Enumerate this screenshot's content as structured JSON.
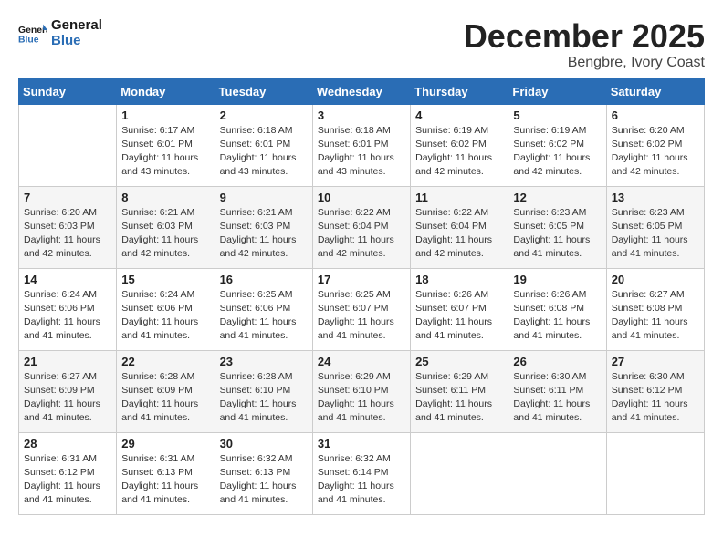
{
  "logo": {
    "text_general": "General",
    "text_blue": "Blue"
  },
  "title": {
    "month_year": "December 2025",
    "location": "Bengbre, Ivory Coast"
  },
  "days_of_week": [
    "Sunday",
    "Monday",
    "Tuesday",
    "Wednesday",
    "Thursday",
    "Friday",
    "Saturday"
  ],
  "weeks": [
    [
      {
        "day": "",
        "sunrise": "",
        "sunset": "",
        "daylight": ""
      },
      {
        "day": "1",
        "sunrise": "Sunrise: 6:17 AM",
        "sunset": "Sunset: 6:01 PM",
        "daylight": "Daylight: 11 hours and 43 minutes."
      },
      {
        "day": "2",
        "sunrise": "Sunrise: 6:18 AM",
        "sunset": "Sunset: 6:01 PM",
        "daylight": "Daylight: 11 hours and 43 minutes."
      },
      {
        "day": "3",
        "sunrise": "Sunrise: 6:18 AM",
        "sunset": "Sunset: 6:01 PM",
        "daylight": "Daylight: 11 hours and 43 minutes."
      },
      {
        "day": "4",
        "sunrise": "Sunrise: 6:19 AM",
        "sunset": "Sunset: 6:02 PM",
        "daylight": "Daylight: 11 hours and 42 minutes."
      },
      {
        "day": "5",
        "sunrise": "Sunrise: 6:19 AM",
        "sunset": "Sunset: 6:02 PM",
        "daylight": "Daylight: 11 hours and 42 minutes."
      },
      {
        "day": "6",
        "sunrise": "Sunrise: 6:20 AM",
        "sunset": "Sunset: 6:02 PM",
        "daylight": "Daylight: 11 hours and 42 minutes."
      }
    ],
    [
      {
        "day": "7",
        "sunrise": "Sunrise: 6:20 AM",
        "sunset": "Sunset: 6:03 PM",
        "daylight": "Daylight: 11 hours and 42 minutes."
      },
      {
        "day": "8",
        "sunrise": "Sunrise: 6:21 AM",
        "sunset": "Sunset: 6:03 PM",
        "daylight": "Daylight: 11 hours and 42 minutes."
      },
      {
        "day": "9",
        "sunrise": "Sunrise: 6:21 AM",
        "sunset": "Sunset: 6:03 PM",
        "daylight": "Daylight: 11 hours and 42 minutes."
      },
      {
        "day": "10",
        "sunrise": "Sunrise: 6:22 AM",
        "sunset": "Sunset: 6:04 PM",
        "daylight": "Daylight: 11 hours and 42 minutes."
      },
      {
        "day": "11",
        "sunrise": "Sunrise: 6:22 AM",
        "sunset": "Sunset: 6:04 PM",
        "daylight": "Daylight: 11 hours and 42 minutes."
      },
      {
        "day": "12",
        "sunrise": "Sunrise: 6:23 AM",
        "sunset": "Sunset: 6:05 PM",
        "daylight": "Daylight: 11 hours and 41 minutes."
      },
      {
        "day": "13",
        "sunrise": "Sunrise: 6:23 AM",
        "sunset": "Sunset: 6:05 PM",
        "daylight": "Daylight: 11 hours and 41 minutes."
      }
    ],
    [
      {
        "day": "14",
        "sunrise": "Sunrise: 6:24 AM",
        "sunset": "Sunset: 6:06 PM",
        "daylight": "Daylight: 11 hours and 41 minutes."
      },
      {
        "day": "15",
        "sunrise": "Sunrise: 6:24 AM",
        "sunset": "Sunset: 6:06 PM",
        "daylight": "Daylight: 11 hours and 41 minutes."
      },
      {
        "day": "16",
        "sunrise": "Sunrise: 6:25 AM",
        "sunset": "Sunset: 6:06 PM",
        "daylight": "Daylight: 11 hours and 41 minutes."
      },
      {
        "day": "17",
        "sunrise": "Sunrise: 6:25 AM",
        "sunset": "Sunset: 6:07 PM",
        "daylight": "Daylight: 11 hours and 41 minutes."
      },
      {
        "day": "18",
        "sunrise": "Sunrise: 6:26 AM",
        "sunset": "Sunset: 6:07 PM",
        "daylight": "Daylight: 11 hours and 41 minutes."
      },
      {
        "day": "19",
        "sunrise": "Sunrise: 6:26 AM",
        "sunset": "Sunset: 6:08 PM",
        "daylight": "Daylight: 11 hours and 41 minutes."
      },
      {
        "day": "20",
        "sunrise": "Sunrise: 6:27 AM",
        "sunset": "Sunset: 6:08 PM",
        "daylight": "Daylight: 11 hours and 41 minutes."
      }
    ],
    [
      {
        "day": "21",
        "sunrise": "Sunrise: 6:27 AM",
        "sunset": "Sunset: 6:09 PM",
        "daylight": "Daylight: 11 hours and 41 minutes."
      },
      {
        "day": "22",
        "sunrise": "Sunrise: 6:28 AM",
        "sunset": "Sunset: 6:09 PM",
        "daylight": "Daylight: 11 hours and 41 minutes."
      },
      {
        "day": "23",
        "sunrise": "Sunrise: 6:28 AM",
        "sunset": "Sunset: 6:10 PM",
        "daylight": "Daylight: 11 hours and 41 minutes."
      },
      {
        "day": "24",
        "sunrise": "Sunrise: 6:29 AM",
        "sunset": "Sunset: 6:10 PM",
        "daylight": "Daylight: 11 hours and 41 minutes."
      },
      {
        "day": "25",
        "sunrise": "Sunrise: 6:29 AM",
        "sunset": "Sunset: 6:11 PM",
        "daylight": "Daylight: 11 hours and 41 minutes."
      },
      {
        "day": "26",
        "sunrise": "Sunrise: 6:30 AM",
        "sunset": "Sunset: 6:11 PM",
        "daylight": "Daylight: 11 hours and 41 minutes."
      },
      {
        "day": "27",
        "sunrise": "Sunrise: 6:30 AM",
        "sunset": "Sunset: 6:12 PM",
        "daylight": "Daylight: 11 hours and 41 minutes."
      }
    ],
    [
      {
        "day": "28",
        "sunrise": "Sunrise: 6:31 AM",
        "sunset": "Sunset: 6:12 PM",
        "daylight": "Daylight: 11 hours and 41 minutes."
      },
      {
        "day": "29",
        "sunrise": "Sunrise: 6:31 AM",
        "sunset": "Sunset: 6:13 PM",
        "daylight": "Daylight: 11 hours and 41 minutes."
      },
      {
        "day": "30",
        "sunrise": "Sunrise: 6:32 AM",
        "sunset": "Sunset: 6:13 PM",
        "daylight": "Daylight: 11 hours and 41 minutes."
      },
      {
        "day": "31",
        "sunrise": "Sunrise: 6:32 AM",
        "sunset": "Sunset: 6:14 PM",
        "daylight": "Daylight: 11 hours and 41 minutes."
      },
      {
        "day": "",
        "sunrise": "",
        "sunset": "",
        "daylight": ""
      },
      {
        "day": "",
        "sunrise": "",
        "sunset": "",
        "daylight": ""
      },
      {
        "day": "",
        "sunrise": "",
        "sunset": "",
        "daylight": ""
      }
    ]
  ]
}
